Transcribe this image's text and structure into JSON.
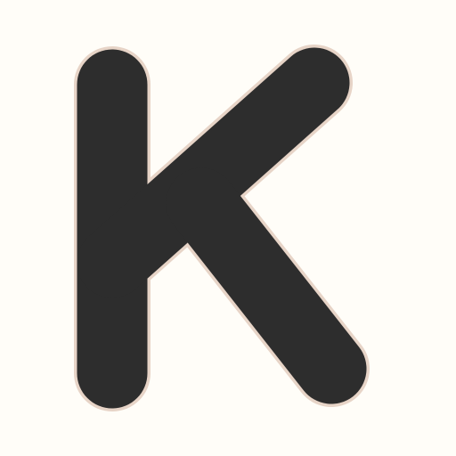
{
  "letter": {
    "glyph": "K",
    "fill_color": "#2d2d2d",
    "outline_color": "#e7d4c7"
  },
  "background_color": "#fffdf8"
}
